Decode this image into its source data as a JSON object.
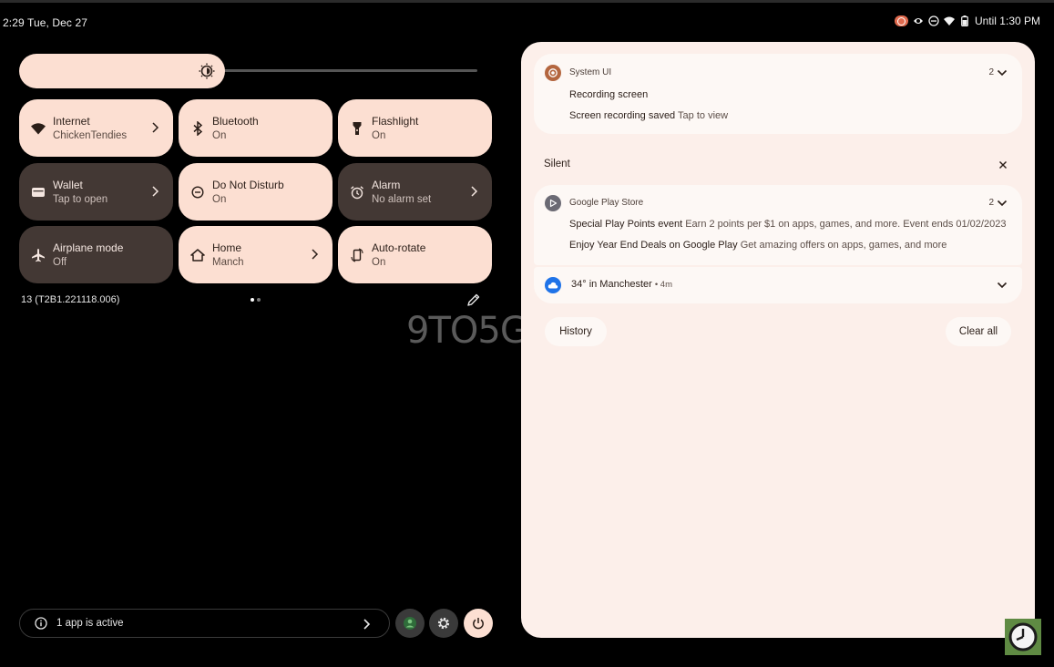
{
  "status": {
    "left_text": "2:29 Tue, Dec 27",
    "right_text": "Until 1:30 PM",
    "icons": [
      "screen-recording-icon",
      "eye-icon",
      "do-not-disturb-icon",
      "wifi-icon",
      "battery-icon"
    ]
  },
  "brightness": {
    "level_percent": 45
  },
  "tiles": [
    {
      "label": "Internet",
      "sub": "ChickenTendies",
      "state": "on",
      "icon": "wifi-icon",
      "chevron": true
    },
    {
      "label": "Bluetooth",
      "sub": "On",
      "state": "on",
      "icon": "bluetooth-icon",
      "chevron": false
    },
    {
      "label": "Flashlight",
      "sub": "On",
      "state": "on",
      "icon": "flashlight-icon",
      "chevron": false
    },
    {
      "label": "Wallet",
      "sub": "Tap to open",
      "state": "off",
      "icon": "wallet-icon",
      "chevron": true
    },
    {
      "label": "Do Not Disturb",
      "sub": "On",
      "state": "on",
      "icon": "do-not-disturb-icon",
      "chevron": false
    },
    {
      "label": "Alarm",
      "sub": "No alarm set",
      "state": "off",
      "icon": "alarm-icon",
      "chevron": true
    },
    {
      "label": "Airplane mode",
      "sub": "Off",
      "state": "off",
      "icon": "airplane-icon",
      "chevron": false
    },
    {
      "label": "Home",
      "sub": "Manch",
      "state": "on",
      "icon": "home-icon",
      "chevron": true
    },
    {
      "label": "Auto-rotate",
      "sub": "On",
      "state": "on",
      "icon": "auto-rotate-icon",
      "chevron": false
    }
  ],
  "build_number": "13 (T2B1.221118.006)",
  "pager": {
    "pages": 2,
    "current": 1
  },
  "watermark": "9TO5G",
  "bottom_bar": {
    "active_apps_label": "1 app is active"
  },
  "notifications": {
    "system_ui": {
      "app": "System UI",
      "count": "2",
      "lines": [
        {
          "title": "Recording screen",
          "text": ""
        },
        {
          "title": "Screen recording saved",
          "text": "Tap to view"
        }
      ]
    },
    "silent_header": "Silent",
    "play_store": {
      "app": "Google Play Store",
      "count": "2",
      "lines": [
        {
          "title": "Special Play Points event",
          "text": "Earn 2 points per $1 on apps, games, and more. Event ends 01/02/2023"
        },
        {
          "title": "Enjoy Year End Deals on Google Play",
          "text": "Get amazing offers on apps, games, and more"
        }
      ]
    },
    "weather": {
      "title": "34° in Manchester",
      "time": "• 4m"
    },
    "history_label": "History",
    "clear_all_label": "Clear all"
  },
  "colors": {
    "tile_on": "#fcdfd2",
    "tile_off": "#433834",
    "panel_bg": "#fcefea",
    "card_bg": "#fdf8f5",
    "system_ui_icon": "#b4663f",
    "weather_icon": "#1f73e8"
  }
}
